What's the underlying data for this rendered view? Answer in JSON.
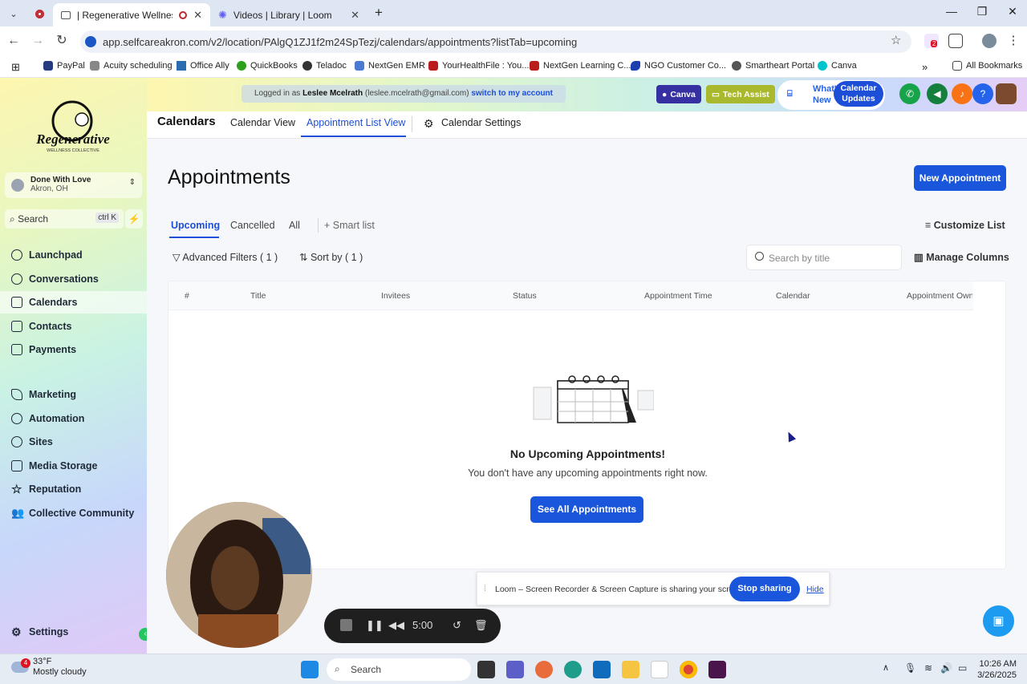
{
  "browser": {
    "tabs": [
      {
        "title": "| Regenerative Wellness Co",
        "active": true
      },
      {
        "title": "Videos | Library | Loom",
        "active": false
      }
    ],
    "new_tab": "+",
    "url": "app.selfcareakron.com/v2/location/PAlgQ1ZJ1f2m24SpTezj/calendars/appointments?listTab=upcoming",
    "extension_badge": "2",
    "bookmarks": [
      "PayPal",
      "Acuity scheduling",
      "Office Ally",
      "QuickBooks",
      "Teladoc",
      "NextGen EMR",
      "YourHealthFile : You...",
      "NextGen Learning C...",
      "NGO Customer Co...",
      "Smartheart Portal",
      "Canva"
    ],
    "bookmarks_more": "»",
    "all_bookmarks": "All Bookmarks"
  },
  "sidebar": {
    "logo_text": "Regenerative",
    "logo_sub": "WELLNESS COLLECTIVE",
    "account": {
      "name": "Done With Love",
      "location": "Akron, OH"
    },
    "search": {
      "label": "Search",
      "shortcut": "ctrl K"
    },
    "items": [
      {
        "label": "Launchpad",
        "icon": "launchpad-icon"
      },
      {
        "label": "Conversations",
        "icon": "chat-icon"
      },
      {
        "label": "Calendars",
        "icon": "calendar-icon",
        "selected": true
      },
      {
        "label": "Contacts",
        "icon": "contacts-icon"
      },
      {
        "label": "Payments",
        "icon": "payments-icon"
      },
      {
        "label": "Marketing",
        "icon": "marketing-icon"
      },
      {
        "label": "Automation",
        "icon": "automation-icon"
      },
      {
        "label": "Sites",
        "icon": "sites-icon"
      },
      {
        "label": "Media Storage",
        "icon": "media-icon"
      },
      {
        "label": "Reputation",
        "icon": "star-icon"
      },
      {
        "label": "Collective Community",
        "icon": "community-icon"
      }
    ],
    "settings": "Settings"
  },
  "header": {
    "logged_in_prefix": "Logged in as",
    "user_name": "Leslee Mcelrath",
    "user_email": "(leslee.mcelrath@gmail.com)",
    "switch": "switch to my account",
    "canva": "Canva",
    "tech_assist": "Tech Assist",
    "whats_new": "What's New",
    "calendar_updates": "Calendar Updates"
  },
  "subnav": {
    "title": "Calendars",
    "calendar_view": "Calendar View",
    "appointment_list": "Appointment List View",
    "settings": "Calendar Settings"
  },
  "main": {
    "title": "Appointments",
    "new_button": "New Appointment",
    "tabs": [
      "Upcoming",
      "Cancelled",
      "All"
    ],
    "smart_list": "+ Smart list",
    "customize": "Customize List",
    "advanced_filters": "Advanced Filters ( 1 )",
    "sort_by": "Sort by ( 1 )",
    "search_placeholder": "Search by title",
    "manage_columns": "Manage Columns",
    "columns": [
      "#",
      "Title",
      "Invitees",
      "Status",
      "Appointment Time",
      "Calendar",
      "Appointment Own"
    ],
    "empty_title": "No Upcoming Appointments!",
    "empty_sub": "You don't have any upcoming appointments right now.",
    "see_all": "See All Appointments"
  },
  "loom": {
    "message": "Loom – Screen Recorder & Screen Capture is sharing your screen.",
    "stop": "Stop sharing",
    "hide": "Hide",
    "timer": "5:00"
  },
  "taskbar": {
    "weather_temp": "33°F",
    "weather_desc": "Mostly cloudy",
    "weather_badge": "4",
    "search": "Search",
    "time": "10:26 AM",
    "date": "3/26/2025"
  }
}
